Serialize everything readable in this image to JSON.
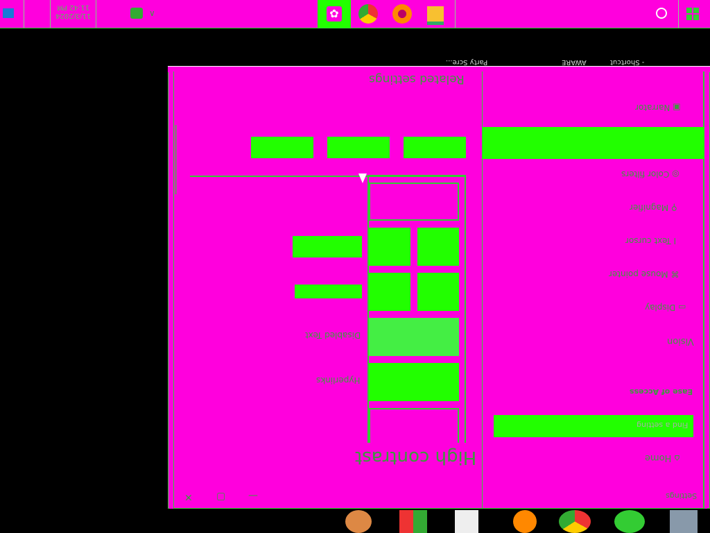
{
  "taskbar": {
    "clock_time": "11:42 PM",
    "clock_date": "11/3/2024",
    "icons": [
      "windows-icon",
      "search-icon",
      "settings-icon",
      "chrome-icon",
      "firefox-icon",
      "file-explorer-icon"
    ]
  },
  "desktop_labels": [
    "- Shortcut",
    "AWARE",
    "Party Scre..."
  ],
  "window": {
    "title": "Settings",
    "page_title": "High contrast",
    "section_header": "Ease of Access",
    "vision_header": "Vision",
    "related_settings": "Related settings",
    "sidebar": {
      "home_label": "Home",
      "search_placeholder": "Find a setting",
      "items": [
        {
          "label": "Display"
        },
        {
          "label": "Mouse pointer"
        },
        {
          "label": "Text cursor"
        },
        {
          "label": "Magnifier"
        },
        {
          "label": "Color filters"
        },
        {
          "label": "Narrator"
        }
      ]
    },
    "swatch_labels": {
      "hyperlinks": "Hyperlinks",
      "disabled_text": "Disabled Text"
    }
  },
  "colors": {
    "magenta": "#ff00dd",
    "green": "#22ff00",
    "border_green": "#33cc33"
  }
}
